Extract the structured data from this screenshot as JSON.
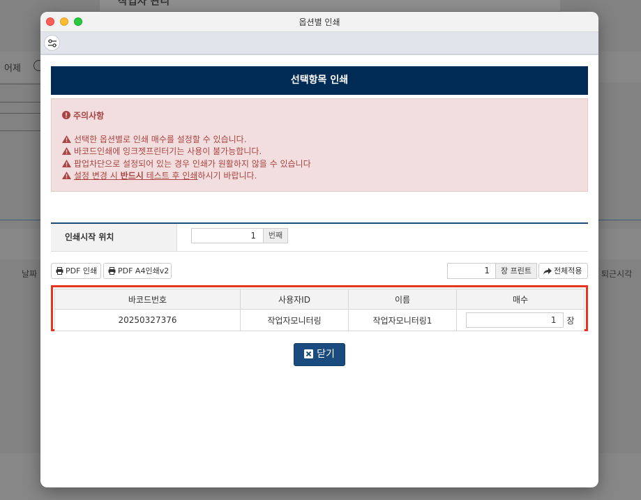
{
  "background": {
    "title": "작업자 관리",
    "left_label": "어제",
    "date_header": "날짜",
    "right_header": "퇴근시각"
  },
  "window": {
    "title": "옵션별 인쇄",
    "toolbar_icon": "settings-sliders-icon"
  },
  "section_header": "선택항목 인쇄",
  "notice": {
    "title": "주의사항",
    "line1": "선택한 옵션별로 인쇄 매수를 설정할 수 있습니다.",
    "line2": "바코드인쇄에 잉크젯프린터기는 사용이 불가능합니다.",
    "line3": "팝업차단으로 설정되어 있는 경우 인쇄가 원활하지 않을 수 있습니다",
    "line4_a": "설정 변경 시 ",
    "line4_b": "반드시",
    "line4_c": " 테스트 후 인쇄",
    "line4_d": "하시기 바랍니다.",
    "colors": {
      "background": "#f2dede",
      "text": "#a94442"
    }
  },
  "start_position": {
    "label": "인쇄시작 위치",
    "value": "1",
    "addon": "번째"
  },
  "buttons": {
    "pdf_print": "PDF 인쇄",
    "pdf_a4": "PDF A4인쇄v2",
    "copies_value": "1",
    "copies_addon": "장 프린트",
    "apply_all": "전체적용",
    "close": "닫기"
  },
  "table": {
    "headers": [
      "바코드번호",
      "사용자ID",
      "이름",
      "매수"
    ],
    "rows": [
      {
        "barcode": "20250327376",
        "user_id": "작업자모니터링",
        "name": "작업자모니터링1",
        "qty": "1",
        "unit": "장"
      }
    ]
  },
  "colors": {
    "header_bg": "#002b54",
    "highlight_border": "#e8331f",
    "close_button": "#1a4b7e"
  }
}
